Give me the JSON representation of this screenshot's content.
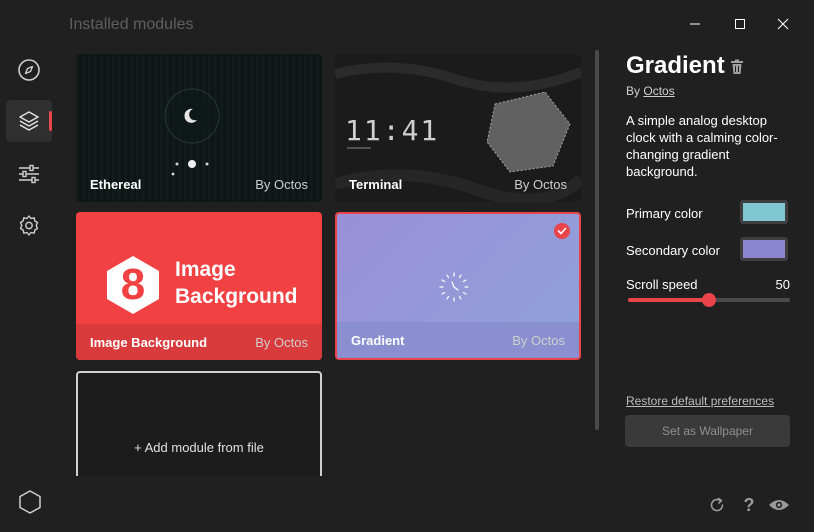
{
  "window": {
    "title": "Installed modules"
  },
  "sidebar": {
    "items": [
      {
        "icon": "compass-icon",
        "active": false
      },
      {
        "icon": "layers-icon",
        "active": true
      },
      {
        "icon": "sliders-icon",
        "active": false
      },
      {
        "icon": "gear-icon",
        "active": false
      }
    ],
    "bottom_icon": "hexagon-icon"
  },
  "modules": [
    {
      "name": "Ethereal",
      "author": "By Octos"
    },
    {
      "name": "Terminal",
      "author": "By Octos",
      "preview_clock": "11:41"
    },
    {
      "name": "Image Background",
      "author": "By Octos",
      "preview_line1": "Image",
      "preview_line2": "Background",
      "preview_badge": "8"
    },
    {
      "name": "Gradient",
      "author": "By Octos",
      "selected": true
    }
  ],
  "add_module": {
    "label": "+ Add module from file"
  },
  "details": {
    "title": "Gradient",
    "by_prefix": "By",
    "author": "Octos",
    "description": "A simple analog desktop clock with a calming color-changing gradient background.",
    "prefs": {
      "primary_label": "Primary color",
      "primary_color": "#7fc8d2",
      "secondary_label": "Secondary color",
      "secondary_color": "#8b85cf",
      "scroll_label": "Scroll speed",
      "scroll_value": "50",
      "scroll_fraction": 0.5
    },
    "restore_label": "Restore default preferences",
    "set_wallpaper_label": "Set as Wallpaper"
  },
  "colors": {
    "accent": "#e84449",
    "background": "#202020"
  }
}
